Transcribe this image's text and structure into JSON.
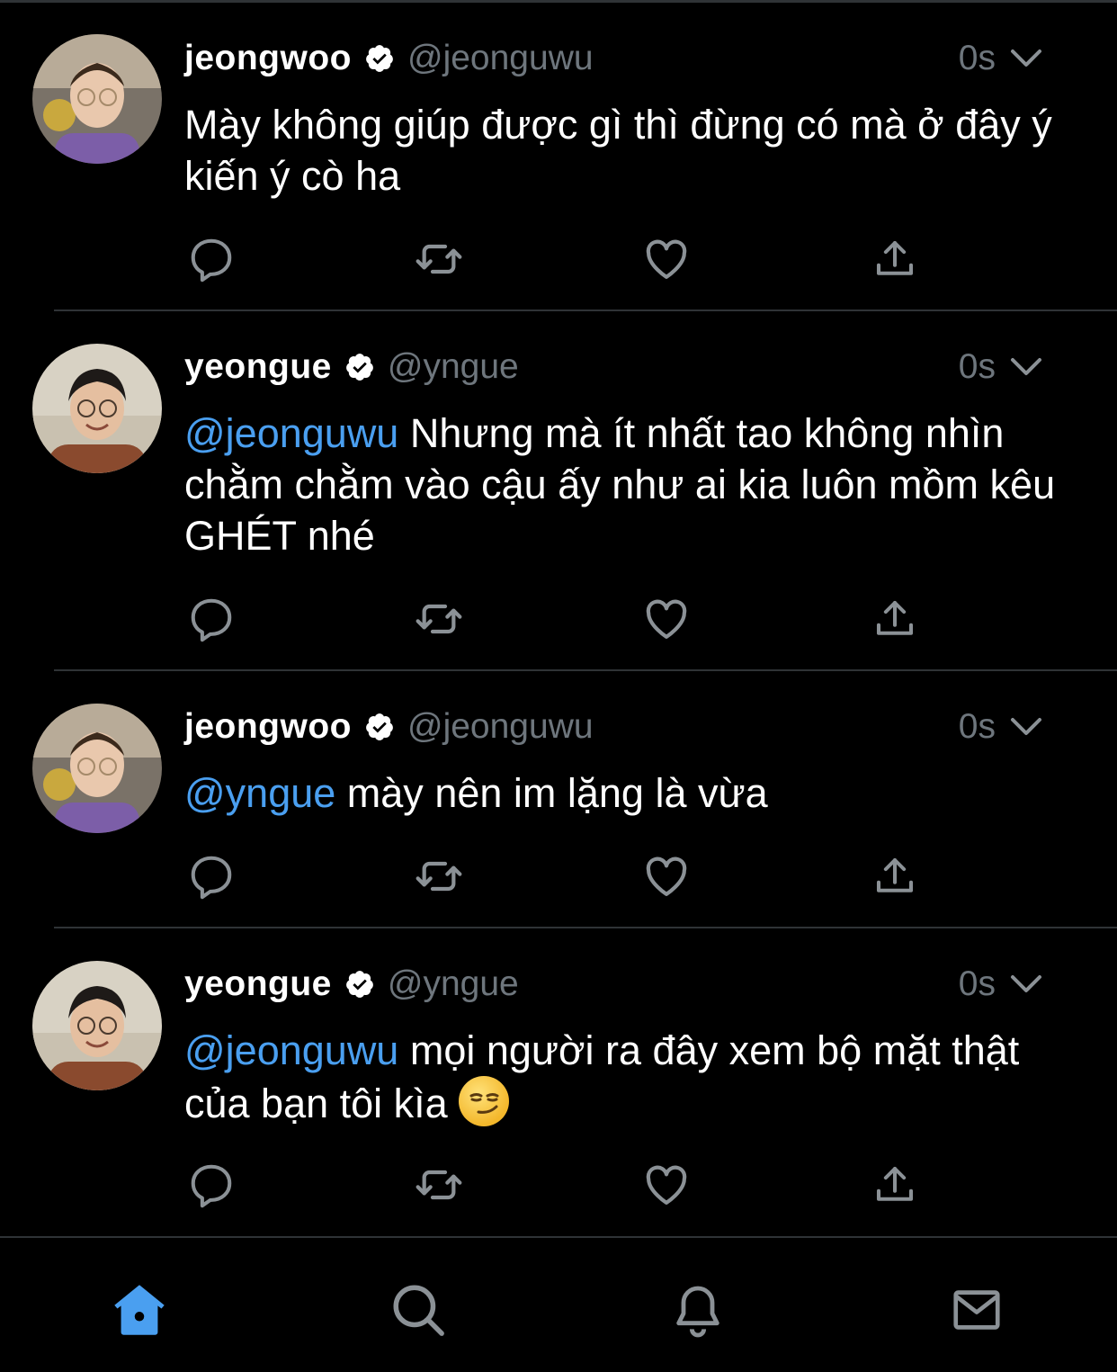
{
  "colors": {
    "background": "#000000",
    "text": "#ffffff",
    "muted": "#6e767d",
    "accent": "#4a9ff0",
    "divider": "#2f3336"
  },
  "tweets": [
    {
      "name": "jeongwoo",
      "handle": "@jeonguwu",
      "time": "0s",
      "mention": "",
      "text": "Mày không giúp được gì thì đừng có mà ở đây ý kiến ý cò ha",
      "avatar": "avatar-jeongwoo"
    },
    {
      "name": "yeongue",
      "handle": "@yngue",
      "time": "0s",
      "mention": "@jeonguwu",
      "text": " Nhưng mà ít nhất tao không nhìn chằm chằm vào cậu ấy như ai kia luôn mồm kêu GHÉT nhé",
      "avatar": "avatar-yeongue"
    },
    {
      "name": "jeongwoo",
      "handle": "@jeonguwu",
      "time": "0s",
      "mention": "@yngue",
      "text": " mày nên im lặng là vừa",
      "avatar": "avatar-jeongwoo"
    },
    {
      "name": "yeongue",
      "handle": "@yngue",
      "time": "0s",
      "mention": "@jeonguwu",
      "text": " mọi người ra đây xem bộ mặt thật của bạn tôi kìa ",
      "emoji": "smirking-face-emoji",
      "avatar": "avatar-yeongue"
    }
  ],
  "tweet_actions": [
    "reply-icon",
    "retweet-icon",
    "like-icon",
    "share-icon"
  ],
  "tabbar": {
    "items": [
      "home-icon",
      "search-icon",
      "notifications-icon",
      "messages-icon"
    ],
    "active": "home-icon"
  }
}
